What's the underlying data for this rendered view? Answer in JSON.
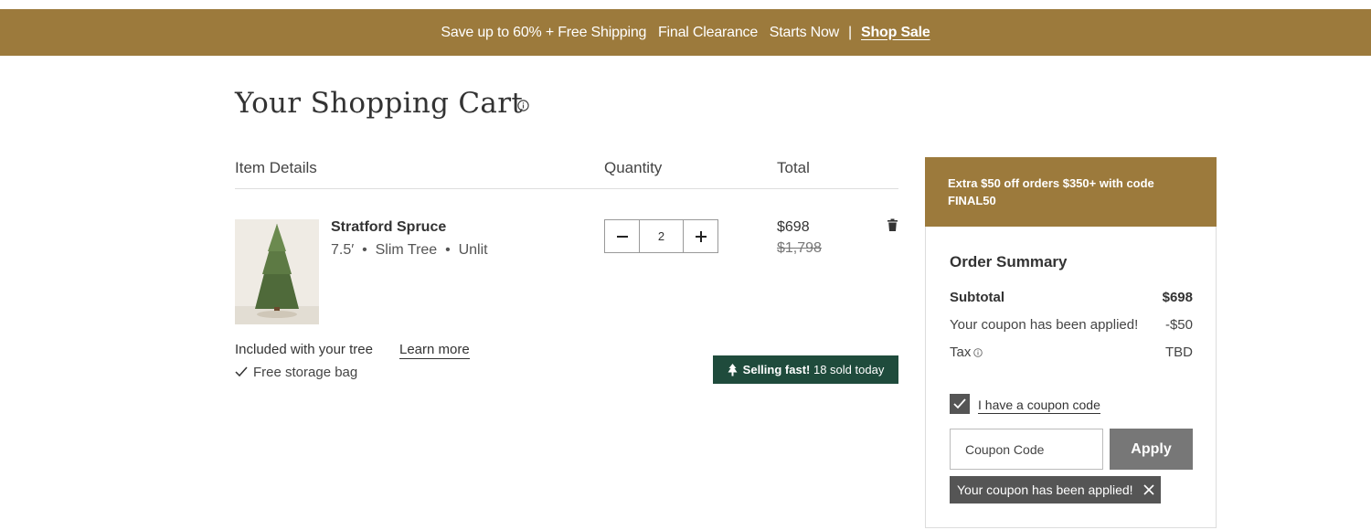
{
  "promo": {
    "part1": "Save up to 60% + Free Shipping",
    "part2": "Final Clearance",
    "part3": "Starts Now",
    "separator": "|",
    "link": "Shop Sale"
  },
  "cart": {
    "title": "Your Shopping Cart",
    "columns": {
      "item": "Item Details",
      "quantity": "Quantity",
      "total": "Total"
    },
    "item": {
      "name": "Stratford Spruce",
      "attributes": "7.5′  •  Slim Tree  •  Unlit",
      "quantity": "2",
      "price": "$698",
      "original_price": "$1,798"
    },
    "included": {
      "label": "Included with your tree",
      "learn_more": "Learn more",
      "items": [
        "Free storage bag"
      ]
    },
    "badge": {
      "strong": "Selling fast!",
      "rest": "18 sold today"
    }
  },
  "summary": {
    "banner": "Extra $50 off orders $350+ with code FINAL50",
    "title": "Order Summary",
    "rows": [
      {
        "label": "Subtotal",
        "value": "$698"
      },
      {
        "label": "Your coupon has been applied!",
        "value": "-$50"
      },
      {
        "label": "Tax",
        "value": "TBD"
      }
    ],
    "coupon": {
      "checkbox_label": "I have a coupon code",
      "checked": true,
      "placeholder": "Coupon Code",
      "apply": "Apply",
      "applied_message": "Your coupon has been applied!"
    }
  },
  "colors": {
    "gold": "#9c7a3c",
    "green": "#1f4b3c",
    "dark_gray": "#555555",
    "button_gray": "#777777"
  },
  "icons": [
    "info-icon",
    "minus-icon",
    "plus-icon",
    "trash-icon",
    "check-icon",
    "tree-icon",
    "close-icon"
  ]
}
